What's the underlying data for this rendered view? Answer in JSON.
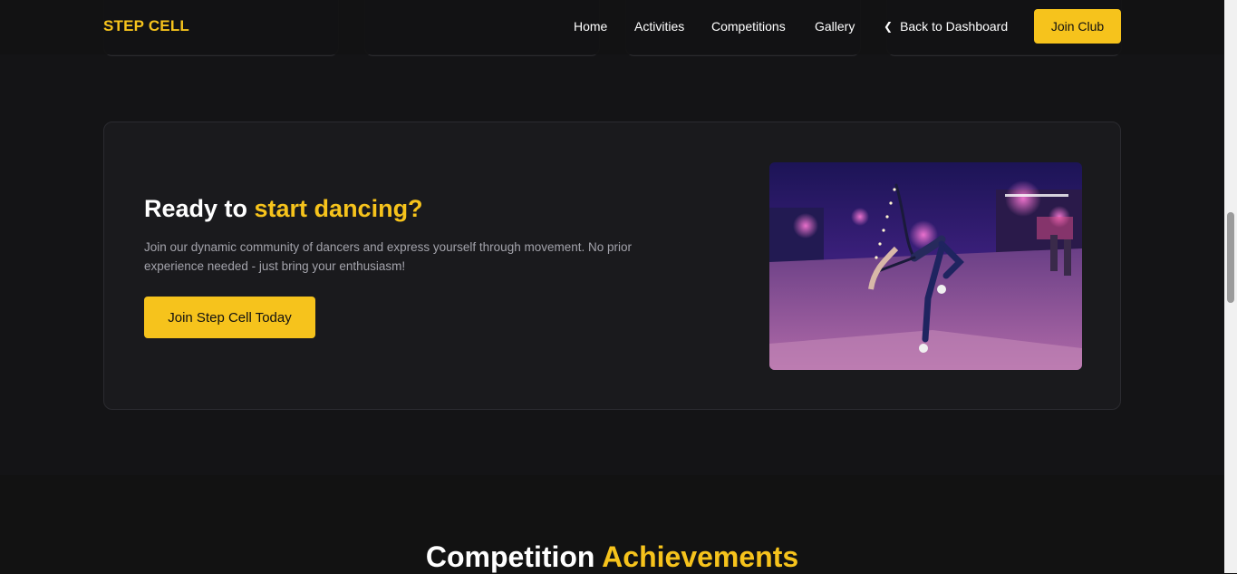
{
  "navbar": {
    "logo": "STEP CELL",
    "links": [
      "Home",
      "Activities",
      "Competitions",
      "Gallery"
    ],
    "back_label": "Back to Dashboard",
    "join_label": "Join Club"
  },
  "cta": {
    "title_part1": "Ready to ",
    "title_accent": "start dancing?",
    "description": "Join our dynamic community of dancers and express yourself through movement. No prior experience needed - just bring your enthusiasm!",
    "button_label": "Join Step Cell Today",
    "image_icon": "dancer-photo"
  },
  "achievements": {
    "title_part1": "Competition ",
    "title_accent": "Achievements"
  },
  "colors": {
    "accent": "#f6c31c",
    "background": "#121212",
    "card": "#1a1a1d"
  }
}
